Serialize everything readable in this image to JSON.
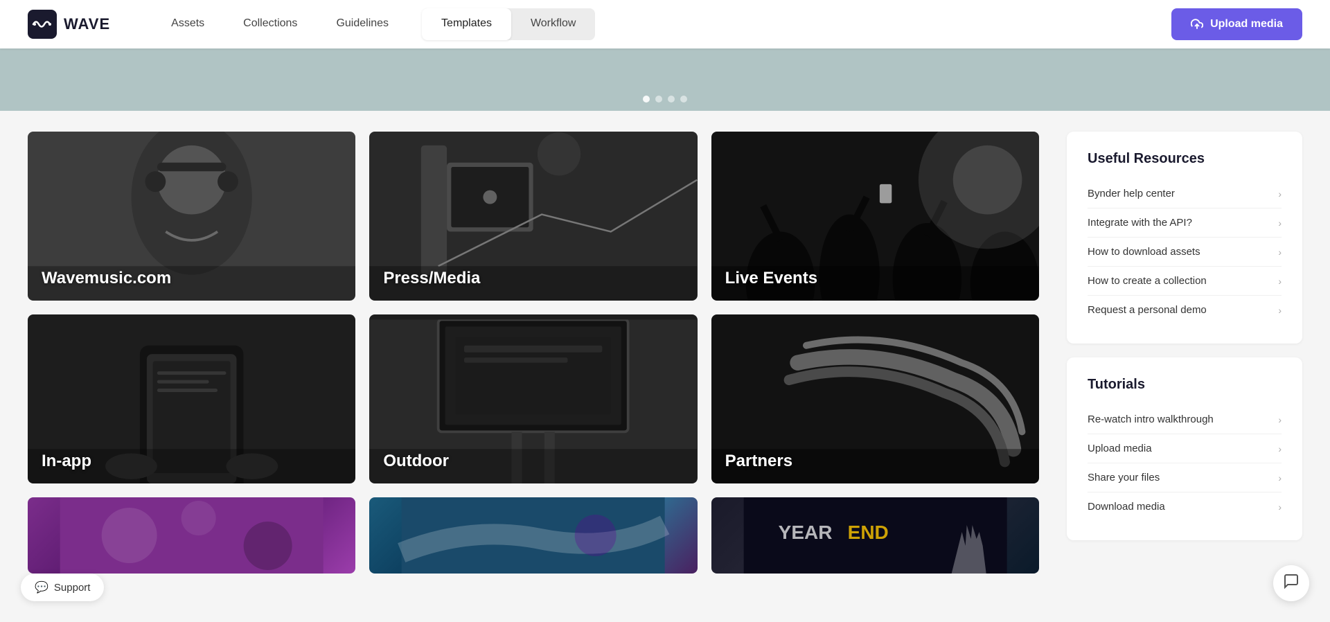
{
  "header": {
    "logo_text": "WAVE",
    "nav_items": [
      {
        "id": "assets",
        "label": "Assets",
        "active": false
      },
      {
        "id": "collections",
        "label": "Collections",
        "active": false
      },
      {
        "id": "guidelines",
        "label": "Guidelines",
        "active": false
      }
    ],
    "tab_items": [
      {
        "id": "templates",
        "label": "Templates",
        "active": true
      },
      {
        "id": "workflow",
        "label": "Workflow",
        "active": false
      }
    ],
    "upload_btn": "Upload media"
  },
  "banner": {
    "dots": [
      1,
      2,
      3,
      4
    ]
  },
  "grid": {
    "rows": [
      [
        {
          "id": "wavemusic",
          "label": "Wavemusic.com",
          "bg": "bg-wavemusic"
        },
        {
          "id": "press",
          "label": "Press/Media",
          "bg": "bg-press"
        },
        {
          "id": "live",
          "label": "Live Events",
          "bg": "bg-live"
        }
      ],
      [
        {
          "id": "inapp",
          "label": "In-app",
          "bg": "bg-inapp"
        },
        {
          "id": "outdoor",
          "label": "Outdoor",
          "bg": "bg-outdoor"
        },
        {
          "id": "partners",
          "label": "Partners",
          "bg": "bg-partners"
        }
      ]
    ],
    "bottom_cards": [
      {
        "id": "card-purple",
        "bg": "bg-purple"
      },
      {
        "id": "card-teal",
        "bg": "bg-teal"
      },
      {
        "id": "card-dark",
        "bg": "bg-dark"
      }
    ]
  },
  "sidebar": {
    "useful_resources": {
      "title": "Useful Resources",
      "links": [
        {
          "id": "bynder-help",
          "label": "Bynder help center"
        },
        {
          "id": "integrate-api",
          "label": "Integrate with the API?"
        },
        {
          "id": "download-assets",
          "label": "How to download assets"
        },
        {
          "id": "create-collection",
          "label": "How to create a collection"
        },
        {
          "id": "personal-demo",
          "label": "Request a personal demo"
        }
      ]
    },
    "tutorials": {
      "title": "Tutorials",
      "links": [
        {
          "id": "intro-walkthrough",
          "label": "Re-watch intro walkthrough"
        },
        {
          "id": "upload-media",
          "label": "Upload media"
        },
        {
          "id": "share-files",
          "label": "Share your files"
        },
        {
          "id": "download-media",
          "label": "Download media"
        }
      ]
    }
  },
  "support": {
    "label": "Support"
  }
}
